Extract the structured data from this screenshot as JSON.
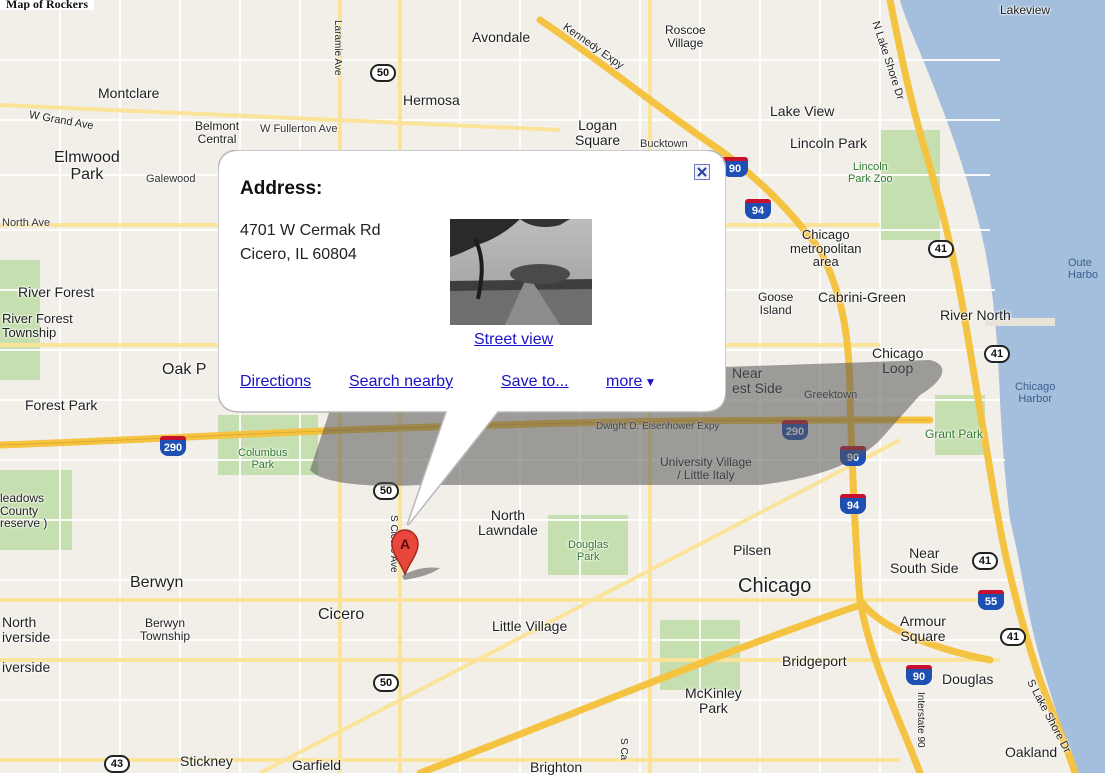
{
  "title_strip": "Map of Rockers",
  "popup": {
    "title": "Address:",
    "address_line1": "4701 W Cermak Rd",
    "address_line2": "Cicero, IL 60804",
    "street_view_label": "Street view",
    "links": {
      "directions": "Directions",
      "search_nearby": "Search nearby",
      "save_to": "Save to...",
      "more": "more",
      "more_arrow": "▼"
    },
    "close_icon": "close-icon"
  },
  "marker": {
    "letter": "A",
    "color": "#e8473b"
  },
  "colors": {
    "water": "#a4bfdd",
    "land": "#f2efe9",
    "highway": "#f5c342",
    "arterial": "#fbe49a",
    "park": "#c6dfb0"
  },
  "map_labels": {
    "lakeview": "Lakeview",
    "avondale": "Avondale",
    "roscoe_village": "Roscoe\nVillage",
    "kennedy_expy": "Kennedy Expy",
    "laramie_ave": "Laramie Ave",
    "montclare": "Montclare",
    "hermosa": "Hermosa",
    "lake_view": "Lake View",
    "w_grand_ave": "W Grand Ave",
    "belmont_central": "Belmont\nCentral",
    "w_fullerton_ave": "W Fullerton Ave",
    "logan_square": "Logan\nSquare",
    "bucktown": "Bucktown",
    "lincoln_park": "Lincoln Park",
    "elmwood_park": "Elmwood\nPark",
    "galewood": "Galewood",
    "lincoln_park_zoo": "Lincoln\nPark Zoo",
    "n_lake_shore_dr": "N Lake Shore Dr",
    "north_ave": "North Ave",
    "chicago_metro": "Chicago\nmetropolitan\narea",
    "outer_harbor": "Oute\nHarbo",
    "river_forest": "River Forest",
    "river_forest_township": "River Forest\nTownship",
    "goose_island": "Goose\nIsland",
    "cabrini_green": "Cabrini-Green",
    "river_north": "River North",
    "oak_park": "Oak P",
    "chicago_loop": "Chicago\nLoop",
    "chicago_harbor": "Chicago\nHarbor",
    "forest_park": "Forest Park",
    "near_west_side": "Near\nest Side",
    "greektown": "Greektown",
    "eisenhower": "Dwight D. Eisenhower Expy",
    "grant_park": "Grant Park",
    "columbus_park": "Columbus\nPark",
    "university_village": "University Village\n/ Little Italy",
    "meadows": "leadows\nCounty\nreserve )",
    "s_cicero_ave": "S Cicero Ave",
    "north_lawndale": "North\nLawndale",
    "douglas_park": "Douglas\nPark",
    "pilsen": "Pilsen",
    "near_south_side": "Near\nSouth Side",
    "berwyn": "Berwyn",
    "chicago": "Chicago",
    "north_riverside": "North\niverside",
    "berwyn_township": "Berwyn\nTownship",
    "cicero": "Cicero",
    "little_village": "Little Village",
    "armour_square": "Armour\nSquare",
    "riverside": "iverside",
    "bridgeport": "Bridgeport",
    "douglas": "Douglas",
    "s_lake_shore_dr": "S Lake Shore Dr",
    "mckinley_park": "McKinley\nPark",
    "interstate_90_94": "Interstate 90",
    "stickney": "Stickney",
    "garfield": "Garfield",
    "brighton": "Brighton",
    "oakland": "Oakland",
    "s_ca": "S Ca"
  },
  "shields": {
    "us50_top": "50",
    "us50_mid": "50",
    "us50_bot": "50",
    "i290_left": "290",
    "i290_right": "290",
    "i90_top": "90",
    "i94_top": "94",
    "i90_mid": "90",
    "i94_mid": "94",
    "i55": "55",
    "i90_bot": "90",
    "us41_top": "41",
    "us41_loop": "41",
    "us41_south": "41",
    "us41_lower": "41",
    "us43": "43"
  }
}
